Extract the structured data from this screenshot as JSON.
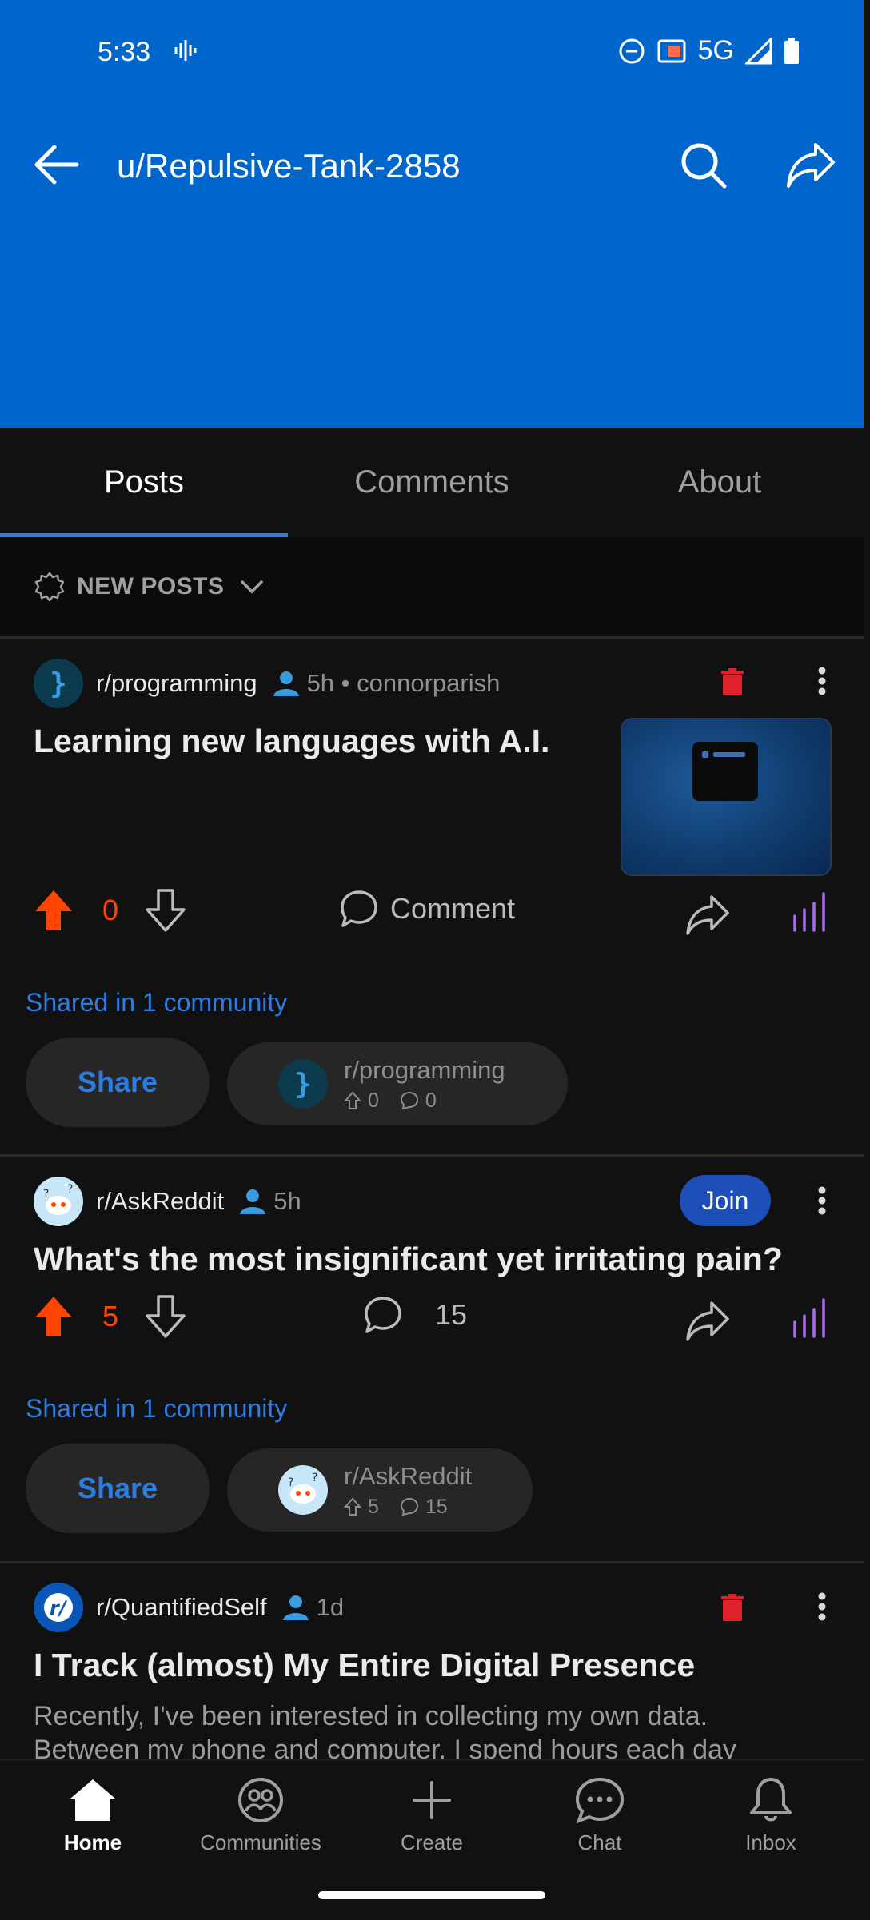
{
  "status": {
    "time": "5:33",
    "network": "5G"
  },
  "header": {
    "title": "u/Repulsive-Tank-2858"
  },
  "tabs": [
    {
      "label": "Posts"
    },
    {
      "label": "Comments"
    },
    {
      "label": "About"
    }
  ],
  "sort": {
    "label": "NEW POSTS"
  },
  "posts": [
    {
      "subreddit": "r/programming",
      "time": "5h • connorparish",
      "title": "Learning new languages with A.I.",
      "votes": "0",
      "comment_label": "Comment",
      "shared": "Shared in 1 community",
      "share_label": "Share",
      "community": {
        "name": "r/programming",
        "upvotes": "0",
        "comments": "0"
      }
    },
    {
      "subreddit": "r/AskReddit",
      "time": "5h",
      "join_label": "Join",
      "title": "What's the most insignificant yet irritating pain?",
      "votes": "5",
      "comments": "15",
      "shared": "Shared in 1 community",
      "share_label": "Share",
      "community": {
        "name": "r/AskReddit",
        "upvotes": "5",
        "comments": "15"
      }
    },
    {
      "subreddit": "r/QuantifiedSelf",
      "time": "1d",
      "title": "I Track (almost) My Entire Digital Presence",
      "body": "Recently, I've been interested in collecting my own data. Between my phone and computer, I spend hours each day"
    }
  ],
  "nav": [
    {
      "label": "Home"
    },
    {
      "label": "Communities"
    },
    {
      "label": "Create"
    },
    {
      "label": "Chat"
    },
    {
      "label": "Inbox"
    }
  ],
  "colors": {
    "header": "#0066cc",
    "accent": "#2d7de0",
    "upvote": "#ff4500",
    "delete": "#e0202a",
    "join": "#1c4fb8"
  }
}
